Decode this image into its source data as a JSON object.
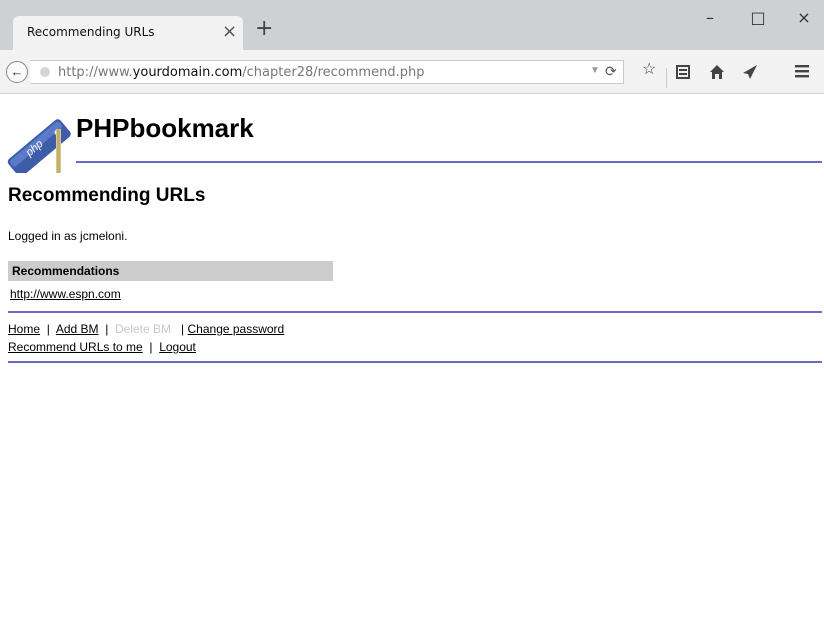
{
  "browser": {
    "tab_title": "Recommending URLs",
    "tab_close": "×",
    "new_tab": "+",
    "minimize": "–",
    "maximize": "□",
    "close": "×",
    "url_prefix": "http://www.",
    "url_domain": "yourdomain.com",
    "url_path": "/chapter28/recommend.php",
    "icons": [
      "back-arrow-icon",
      "reload-icon",
      "star-icon",
      "reading-list-icon",
      "home-icon",
      "send-icon",
      "menu-icon"
    ]
  },
  "header": {
    "site_title": "PHPbookmark",
    "logo_text": "php"
  },
  "main": {
    "page_title": "Recommending URLs",
    "logged_in": "Logged in as jcmeloni.",
    "recommendations_header": "Recommendations",
    "recommendations": [
      "http://www.espn.com"
    ]
  },
  "menu": {
    "home": "Home",
    "add_bm": "Add BM",
    "delete_bm": "Delete BM",
    "change_password": "Change password",
    "recommend": "Recommend URLs to me",
    "logout": "Logout",
    "sep": "|"
  },
  "colors": {
    "rule": "#6a6ac4",
    "table_header": "#cccccc",
    "titlebar": "#cfd0d2"
  }
}
